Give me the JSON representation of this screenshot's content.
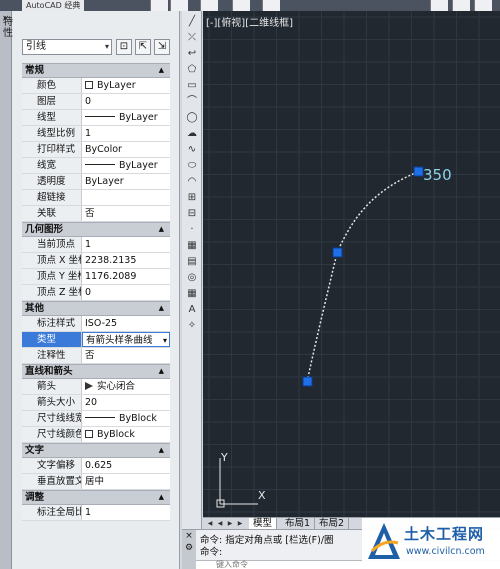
{
  "titlebar": {
    "app_name": "AutoCAD 经典"
  },
  "palette": {
    "title_chars": [
      "特",
      "性"
    ],
    "close_icon": "×",
    "object_type": "引线",
    "sections": [
      {
        "title": "常规",
        "rows": [
          {
            "key": "颜色",
            "value": "ByLayer",
            "kind": "swatch"
          },
          {
            "key": "图层",
            "value": "0"
          },
          {
            "key": "线型",
            "value": "ByLayer",
            "kind": "line"
          },
          {
            "key": "线型比例",
            "value": "1"
          },
          {
            "key": "打印样式",
            "value": "ByColor"
          },
          {
            "key": "线宽",
            "value": "ByLayer",
            "kind": "line"
          },
          {
            "key": "透明度",
            "value": "ByLayer"
          },
          {
            "key": "超链接",
            "value": ""
          },
          {
            "key": "关联",
            "value": "否"
          }
        ]
      },
      {
        "title": "几何图形",
        "rows": [
          {
            "key": "当前顶点",
            "value": "1"
          },
          {
            "key": "顶点 X 坐标",
            "value": "2238.2135"
          },
          {
            "key": "顶点 Y 坐标",
            "value": "1176.2089"
          },
          {
            "key": "顶点 Z 坐标",
            "value": "0"
          }
        ]
      },
      {
        "title": "其他",
        "rows": [
          {
            "key": "标注样式",
            "value": "ISO-25"
          },
          {
            "key": "类型",
            "value": "有箭头样条曲线",
            "selected": true,
            "dropdown": true
          },
          {
            "key": "注释性",
            "value": "否"
          }
        ]
      },
      {
        "title": "直线和箭头",
        "rows": [
          {
            "key": "箭头",
            "value": "实心闭合",
            "kind": "arrow"
          },
          {
            "key": "箭头大小",
            "value": "20"
          },
          {
            "key": "尺寸线线宽",
            "value": "ByBlock",
            "kind": "line"
          },
          {
            "key": "尺寸线颜色",
            "value": "ByBlock",
            "kind": "swatch"
          }
        ]
      },
      {
        "title": "文字",
        "rows": [
          {
            "key": "文字偏移",
            "value": "0.625"
          },
          {
            "key": "垂直放置文字",
            "value": "居中"
          }
        ]
      },
      {
        "title": "调整",
        "rows": [
          {
            "key": "标注全局比例",
            "value": "1"
          }
        ]
      }
    ]
  },
  "viewport": {
    "label": "[-][俯视][二维线框]",
    "annotation": "350",
    "ucs_x": "X",
    "ucs_y": "Y"
  },
  "layout_tabs": [
    "模型",
    "布局1",
    "布局2"
  ],
  "command": {
    "line1": "命令: 指定对角点或 [栏选(F)/圈",
    "line2": "命令:",
    "input": "键入命令"
  },
  "watermark": {
    "title": "土木工程网",
    "url": "www.civilcn.com"
  },
  "colors": {
    "viewport_bg": "#212830",
    "grip": "#1f6fe8",
    "leader": "#e6e6e6",
    "annotation": "#8fd3e8",
    "selected_row": "#3b7ad9"
  }
}
